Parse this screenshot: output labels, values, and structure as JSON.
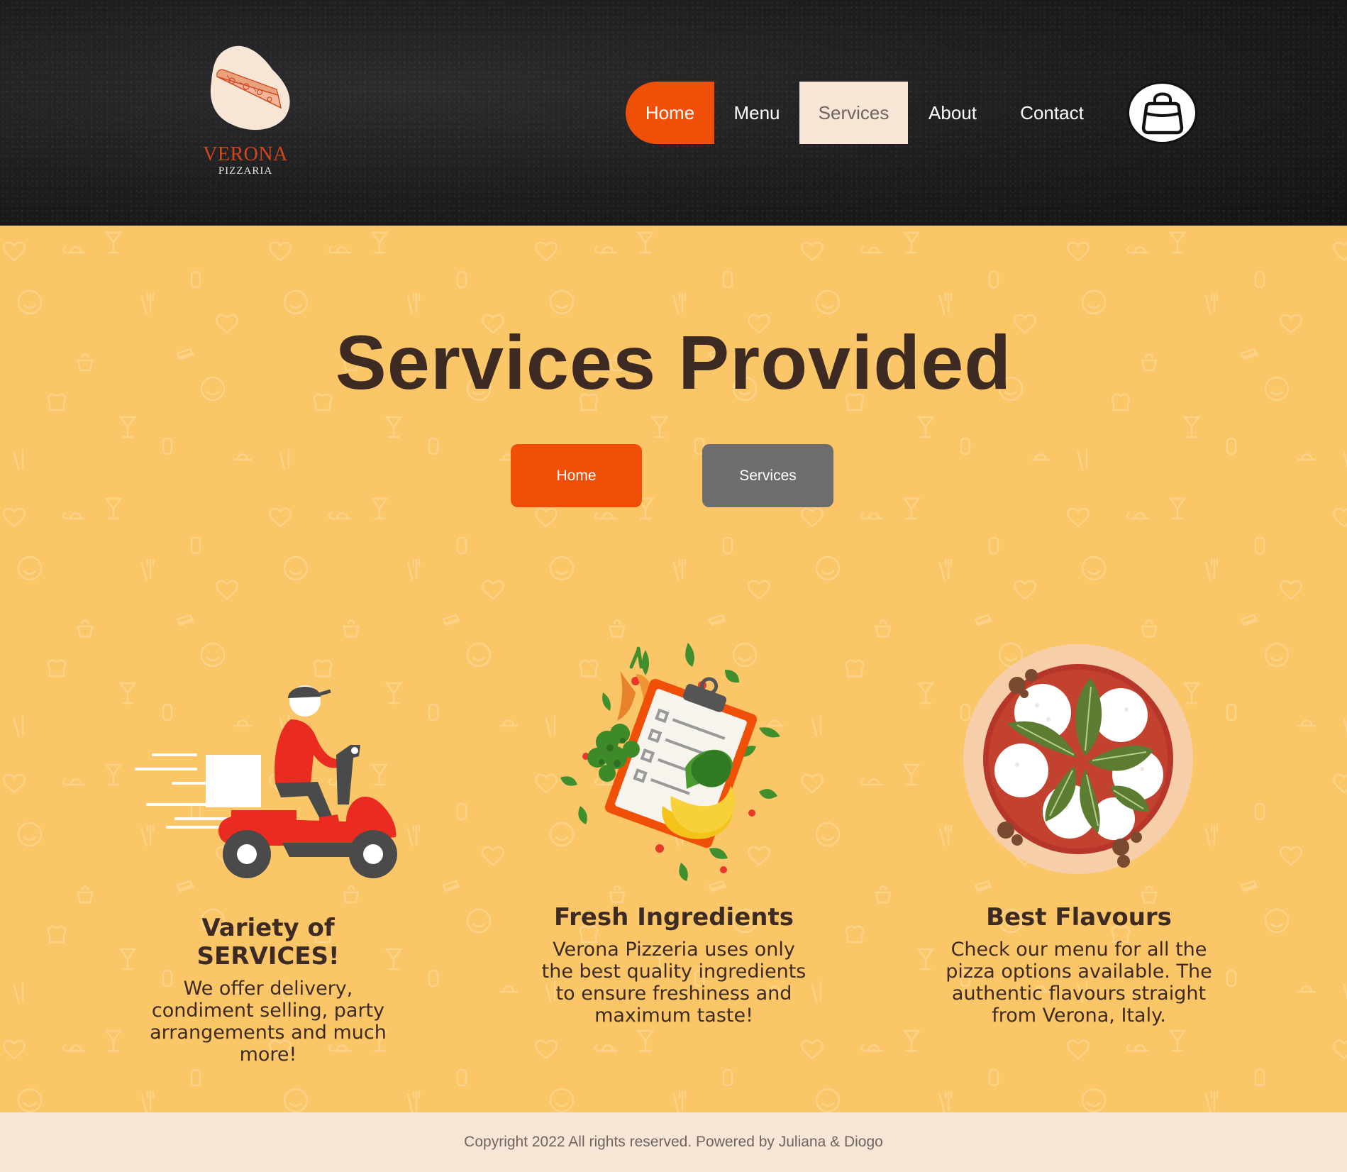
{
  "header": {
    "logo": {
      "brand": "VERONA",
      "subtitle": "PIZZARIA"
    },
    "nav": {
      "home": "Home",
      "menu": "Menu",
      "services": "Services",
      "about": "About",
      "contact": "Contact"
    },
    "cart_icon": "shopping-bag-icon"
  },
  "main": {
    "title": "Services Provided",
    "breadcrumb": {
      "home": "Home",
      "current": "Services"
    },
    "features": [
      {
        "icon": "delivery-scooter-illustration",
        "title": "Variety of SERVICES!",
        "text": "We offer delivery, condiment selling, party arrangements and much more!"
      },
      {
        "icon": "fresh-ingredients-illustration",
        "title": "Fresh Ingredients",
        "text": "Verona Pizzeria uses only the best quality ingredients to ensure freshiness and maximum taste!"
      },
      {
        "icon": "pizza-illustration",
        "title": "Best Flavours",
        "text": "Check our menu for all the pizza options available. The authentic flavours straight from Verona, Italy."
      }
    ]
  },
  "footer": {
    "copyright": "Copyright 2022 All rights reserved. Powered by Juliana & Diogo"
  },
  "colors": {
    "accent": "#f04f08",
    "background": "#fac667",
    "header": "#1d1d1f",
    "text": "#3d2a23",
    "footer": "#f7e6d6"
  }
}
